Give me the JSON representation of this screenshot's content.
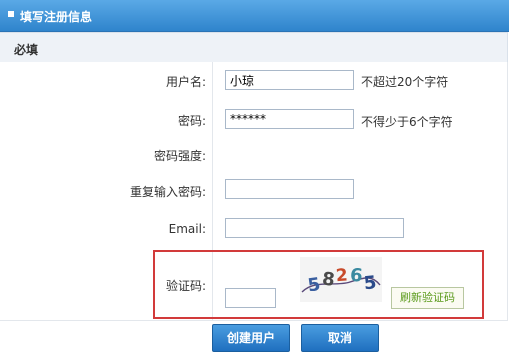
{
  "header": {
    "title": "填写注册信息"
  },
  "section": {
    "title": "必填"
  },
  "fields": {
    "username": {
      "label": "用户名:",
      "value": "小琼",
      "hint": "不超过20个字符"
    },
    "password": {
      "label": "密码:",
      "value": "******",
      "hint": "不得少于6个字符"
    },
    "strength": {
      "label": "密码强度:"
    },
    "confirm": {
      "label": "重复输入密码:",
      "value": ""
    },
    "email": {
      "label": "Email:",
      "value": ""
    },
    "captcha": {
      "label": "验证码:",
      "value": "",
      "code": [
        "5",
        "8",
        "2",
        "6",
        "5"
      ],
      "refresh_label": "刷新验证码"
    }
  },
  "actions": {
    "create_label": "创建用户",
    "cancel_label": "取消"
  },
  "colors": {
    "header": "#2f84cc",
    "highlight_border": "#d23a3a",
    "button": "#1f6fbf"
  }
}
